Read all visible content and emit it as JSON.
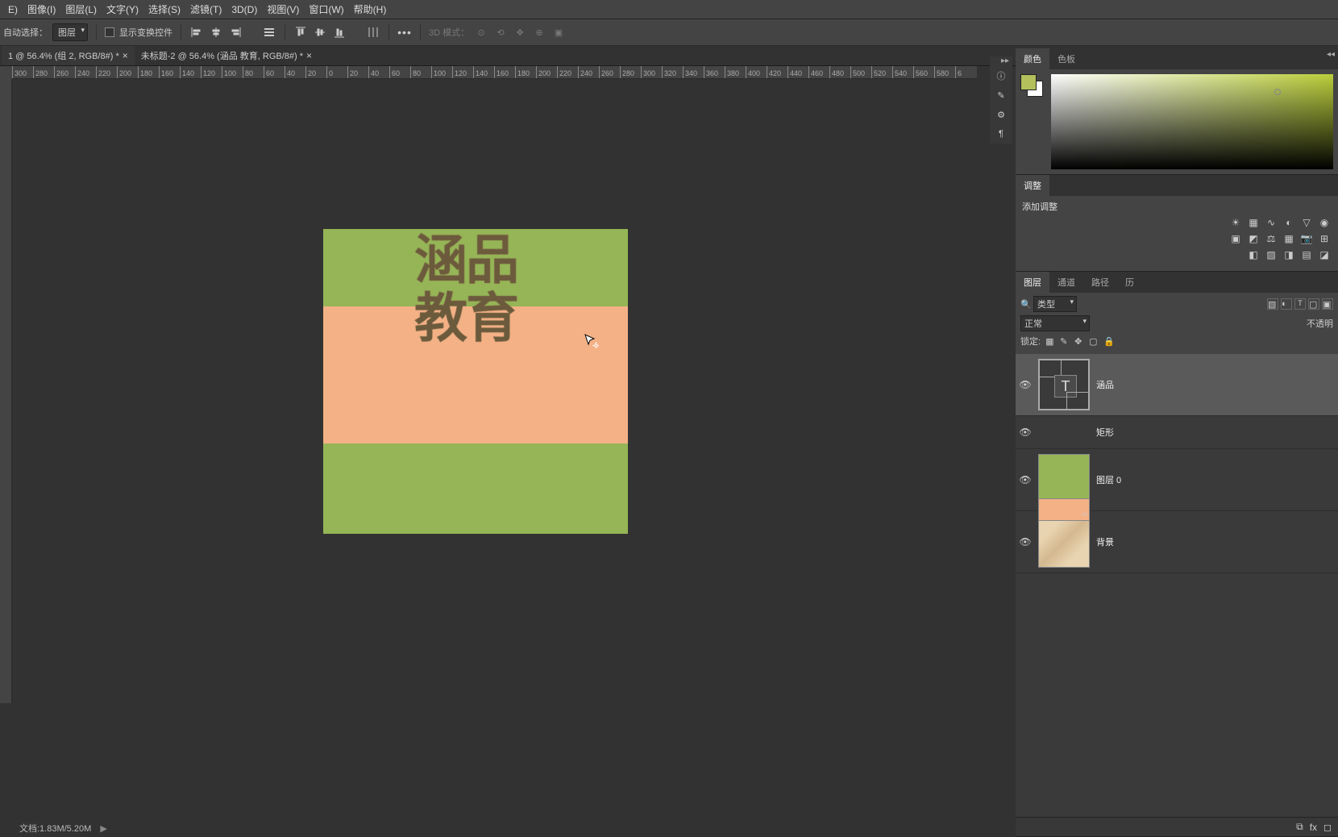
{
  "menu": {
    "items": [
      "E)",
      "图像(I)",
      "图层(L)",
      "文字(Y)",
      "选择(S)",
      "滤镜(T)",
      "3D(D)",
      "视图(V)",
      "窗口(W)",
      "帮助(H)"
    ]
  },
  "options": {
    "autoSelectLabel": "自动选择：",
    "layerSelect": "图层",
    "showTransformLabel": "显示变换控件",
    "mode3d": "3D 模式："
  },
  "tabs": [
    {
      "label": "1 @ 56.4% (组 2, RGB/8#) *"
    },
    {
      "label": "未标题-2 @ 56.4% (涵品 教育, RGB/8#) *"
    }
  ],
  "ruler": {
    "values": [
      "300",
      "280",
      "260",
      "240",
      "220",
      "200",
      "180",
      "160",
      "140",
      "120",
      "100",
      "80",
      "60",
      "40",
      "20",
      "0",
      "20",
      "40",
      "60",
      "80",
      "100",
      "120",
      "140",
      "160",
      "180",
      "200",
      "220",
      "240",
      "260",
      "280",
      "300",
      "320",
      "340",
      "360",
      "380",
      "400",
      "420",
      "440",
      "460",
      "480",
      "500",
      "520",
      "540",
      "560",
      "580",
      "6"
    ]
  },
  "canvas": {
    "text1": "涵品",
    "text2": "教育"
  },
  "status": {
    "doc": "文档:1.83M/5.20M"
  },
  "colorPanel": {
    "tabs": [
      "颜色",
      "色板"
    ]
  },
  "adjustPanel": {
    "title": "调整",
    "addLabel": "添加调整"
  },
  "layersPanel": {
    "tabs": [
      "图层",
      "通道",
      "路径",
      "历"
    ],
    "kindLabel": "类型",
    "blend": "正常",
    "opacityLabel": "不透明",
    "lockLabel": "锁定:",
    "layers": [
      {
        "name": "涵品",
        "type": "T"
      },
      {
        "name": "矩形",
        "type": "shape"
      },
      {
        "name": "图层 0",
        "type": "green"
      },
      {
        "name": "背景",
        "type": "fabric"
      }
    ]
  },
  "colors": {
    "fg": "#b3c05c",
    "bg": "#ffffff",
    "orange": "#f4b186",
    "green": "#95b556"
  }
}
